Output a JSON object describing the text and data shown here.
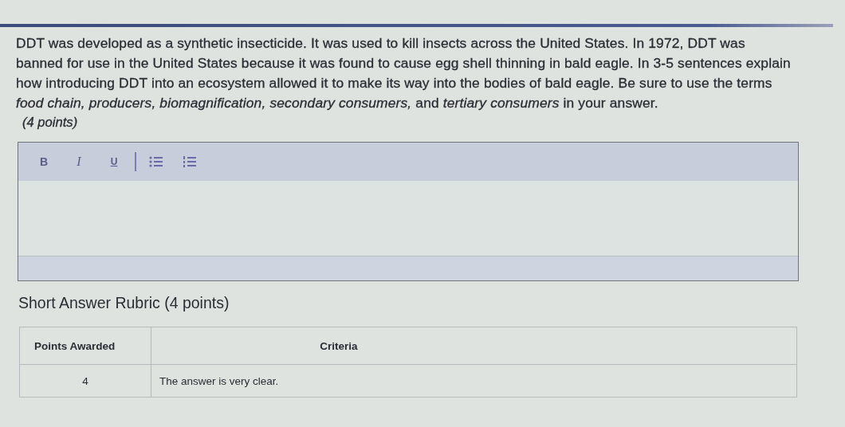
{
  "question": {
    "text": "DDT was developed as a synthetic insecticide. It was used to kill insects across the United States. In 1972, DDT was banned for use in the United States because it was found to cause egg shell thinning in bald eagle. In 3-5 sentences explain how introducing DDT into an ecosystem allowed it to make its way into the bodies of bald eagle. Be sure to use the terms *food chain, producers, biomagnification, secondary consumers,* and *tertiary consumers* in your answer.",
    "points": "(4 points)"
  },
  "editor": {
    "toolbar": [
      {
        "kind": "bold",
        "label": "B"
      },
      {
        "kind": "italic",
        "label": "I"
      },
      {
        "kind": "underline",
        "label": "U"
      },
      {
        "kind": "separator"
      },
      {
        "kind": "bullet-list"
      },
      {
        "kind": "numbered-list"
      }
    ]
  },
  "rubric": {
    "title": "Short Answer Rubric (4 points)",
    "columns": [
      "Points Awarded",
      "Criteria"
    ],
    "rows": [
      {
        "points": "4",
        "criteria": "The answer is very clear."
      }
    ]
  }
}
